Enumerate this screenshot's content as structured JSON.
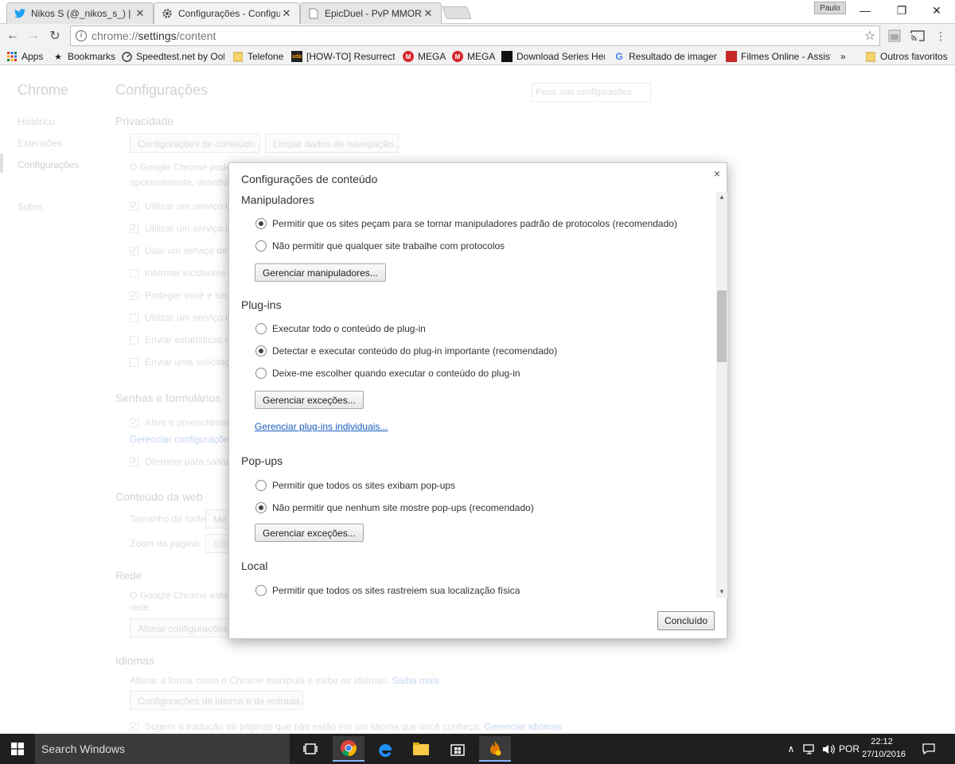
{
  "tabs": [
    {
      "title": "Nikos S (@_nikos_s_) | Tw",
      "icon": "twitter-icon",
      "color": "#1da1f2"
    },
    {
      "title": "Configurações - Configur",
      "icon": "gear-icon",
      "color": "#555555"
    },
    {
      "title": "EpicDuel - PvP MMORPG",
      "icon": "page-icon",
      "color": "#999999"
    }
  ],
  "profile_name": "Paulo",
  "window_controls": {
    "minimize": "—",
    "maximize": "❐",
    "close": "✕"
  },
  "address_bar": {
    "url_prefix": "chrome://",
    "url_main": "settings",
    "url_suffix": "/content"
  },
  "bookmarks": [
    {
      "label": "Apps",
      "icon": "apps-grid-icon"
    },
    {
      "label": "Bookmarks",
      "icon": "star-icon"
    },
    {
      "label": "Speedtest.net by Ook",
      "icon": "speedtest-icon"
    },
    {
      "label": "Telefone",
      "icon": "folder-icon"
    },
    {
      "label": "[HOW-TO] Resurrectir",
      "icon": "xda-icon"
    },
    {
      "label": "MEGA",
      "icon": "mega-icon"
    },
    {
      "label": "MEGA",
      "icon": "mega-icon"
    },
    {
      "label": "Download Series Here",
      "icon": "download-series-icon"
    },
    {
      "label": "Resultado de imagem",
      "icon": "google-icon"
    },
    {
      "label": "Filmes Online - Assist",
      "icon": "filmes-icon"
    },
    {
      "label": "»",
      "icon": "overflow-icon"
    },
    {
      "label": "Outros favoritos",
      "icon": "folder-icon"
    }
  ],
  "sidebar": {
    "title": "Chrome",
    "items": [
      "Histórico",
      "Extensões",
      "Configurações",
      "Sobre"
    ]
  },
  "settings": {
    "title": "Configurações",
    "search_placeholder": "Pesq. nas configurações",
    "privacy": {
      "heading": "Privacidade",
      "btn_content": "Configurações de conteúdo...",
      "btn_clear": "Limpar dados de navegação...",
      "desc1": "O Google Chrome pode u",
      "desc2": "opcionalmente, desativa",
      "checks": [
        {
          "label": "Utilizar um serviço de",
          "checked": true
        },
        {
          "label": "Utilizar um serviço de",
          "checked": true
        },
        {
          "label": "Usar um serviço de p",
          "checked": true
        },
        {
          "label": "Informar incidentes d",
          "checked": false
        },
        {
          "label": "Proteger você e seu d",
          "checked": true
        },
        {
          "label": "Utilizar um serviço da",
          "checked": false
        },
        {
          "label": "Enviar estatísticas de",
          "checked": false
        },
        {
          "label": "Enviar uma solicitaçã",
          "checked": false
        }
      ]
    },
    "passwords": {
      "heading": "Senhas e formulários",
      "check1": "Ative o preenchiment",
      "link": "Gerenciar configurações d",
      "check2": "Oferecer para salvar s"
    },
    "web": {
      "heading": "Conteúdo da web",
      "font_label": "Tamanho da fonte:",
      "font_value": "Mé",
      "zoom_label": "Zoom da página:",
      "zoom_value": "100"
    },
    "network": {
      "heading": "Rede",
      "desc1": "O Google Chrome está us",
      "desc2": "rede.",
      "btn": "Alterar configurações d"
    },
    "languages": {
      "heading": "Idiomas",
      "desc": "Alterar a forma como o Chrome manipula e exibe os idiomas.",
      "desc_link": "Saiba mais",
      "btn": "Configurações de idioma e de entrada...",
      "check": "Sugerir a tradução de páginas que não estão em um idioma que você conheça.",
      "check_link": "Gerenciar idiomas"
    }
  },
  "dialog": {
    "title": "Configurações de conteúdo",
    "close": "×",
    "handlers": {
      "heading": "Manipuladores",
      "opt1": "Permitir que os sites peçam para se tornar manipuladores padrão de protocolos (recomendado)",
      "opt2": "Não permitir que qualquer site trabalhe com protocolos",
      "btn": "Gerenciar manipuladores..."
    },
    "plugins": {
      "heading": "Plug-ins",
      "opt1": "Executar todo o conteúdo de plug-in",
      "opt2": "Detectar e executar conteúdo do plug-in importante (recomendado)",
      "opt3": "Deixe-me escolher quando executar o conteúdo do plug-in",
      "btn": "Gerenciar exceções...",
      "link": "Gerenciar plug-ins individuais..."
    },
    "popups": {
      "heading": "Pop-ups",
      "opt1": "Permitir que todos os sites exibam pop-ups",
      "opt2": "Não permitir que nenhum site mostre pop-ups (recomendado)",
      "btn": "Gerenciar exceções..."
    },
    "location": {
      "heading": "Local",
      "opt1": "Permitir que todos os sites rastreiem sua localização física"
    },
    "done": "Concluído"
  },
  "taskbar": {
    "search": "Search Windows",
    "language": "POR",
    "time": "22:12",
    "date": "27/10/2016"
  },
  "colors": {
    "link_blue": "#1a5dbe",
    "taskbar_bg": "#1f1f1f",
    "windows_blue": "#0078d7"
  }
}
